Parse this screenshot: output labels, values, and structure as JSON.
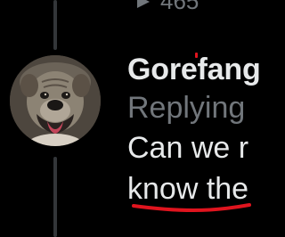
{
  "top_metric": {
    "icon": "views-icon",
    "value": "465"
  },
  "tweet": {
    "author_display_name": "Gorefang",
    "replying_to_prefix": "Replying",
    "text_line_1": "Can we r",
    "text_line_2": "know the"
  },
  "avatar": {
    "description_icon": "dog-avatar"
  },
  "colors": {
    "background": "#000000",
    "primary_text": "#e7e9ea",
    "secondary_text": "#71767b",
    "thread_line": "#333639",
    "annotation_red": "#e0141e"
  }
}
